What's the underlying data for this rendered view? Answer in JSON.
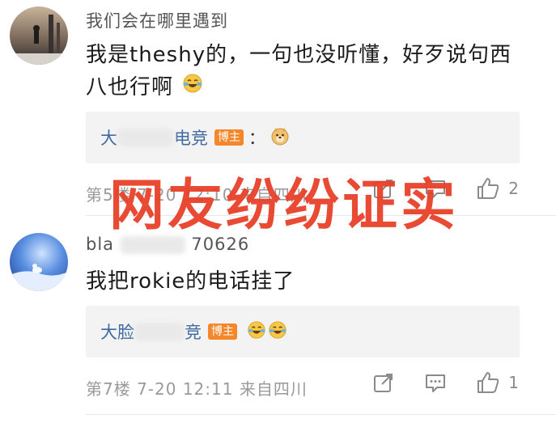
{
  "comments": [
    {
      "username_visible": "我们会在哪里遇到",
      "text_line1": "我是theshy的，一句也没听懂，好歹说句西",
      "text_line2": "八也行啊",
      "reply": {
        "name_start": "大",
        "name_end": "电竞",
        "badge": "博主",
        "colon": "："
      },
      "meta": "第5楼 7-20 12:10 来自四川",
      "like_count": "2"
    },
    {
      "username_start": "bla",
      "username_end": "70626",
      "text": "我把rokie的电话挂了",
      "reply": {
        "name_start": "大脸",
        "name_end": "竞",
        "badge": "博主"
      },
      "meta": "第7楼 7-20 12:11 来自四川",
      "like_count": "1"
    }
  ],
  "overlay_caption": "网友纷纷证实",
  "colors": {
    "accent_red": "#e8412a",
    "reply_name": "#3f6aa0",
    "badge_orange": "#f5862a",
    "meta_gray": "#9a9a9a"
  },
  "icons": [
    "share-icon",
    "comment-icon",
    "like-icon",
    "doge-emoji-icon",
    "laugh-cry-emoji-icon"
  ]
}
